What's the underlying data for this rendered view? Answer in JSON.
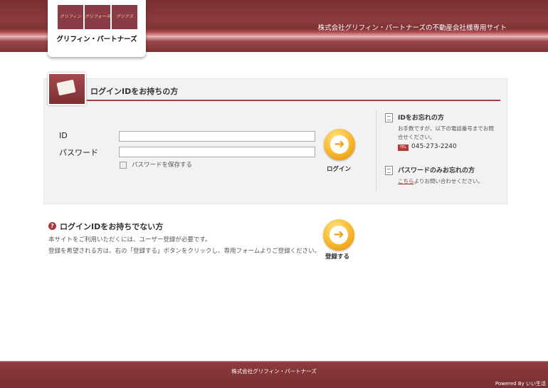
{
  "header": {
    "logo_tiles": [
      "グリフィン",
      "グリフォーネ",
      "グリアス"
    ],
    "logo_name": "グリフィン・パートナーズ",
    "site_title": "株式会社グリフィン・パートナーズの不動産会社様専用サイト"
  },
  "login": {
    "title": "ログインIDをお持ちの方",
    "id_label": "ID",
    "id_value": "",
    "password_label": "パスワード",
    "password_value": "",
    "save_password_label": "パスワードを保存する",
    "save_password_checked": false,
    "login_button_label": "ログイン"
  },
  "help": {
    "forgot_id_title": "IDをお忘れの方",
    "forgot_id_text": "お手数ですが、以下の電話番号までお問合せください。",
    "tel_badge": "TEL",
    "tel_number": "045-273-2240",
    "forgot_pw_title": "パスワードのみお忘れの方",
    "forgot_pw_link": "こちら",
    "forgot_pw_text": "よりお問い合わせください。"
  },
  "register": {
    "title": "ログインIDをお持ちでない方",
    "line1": "本サイトをご利用いただくには、ユーザー登録が必要です。",
    "line2": "登録を希望される方は、右の「登録する」ボタンをクリックし、専用フォームよりご登録ください。",
    "button_label": "登録する"
  },
  "footer": {
    "company": "株式会社グリフィン・パートナーズ",
    "powered_by": "Powered By いい生活"
  },
  "colors": {
    "brand": "#8d3a3d",
    "accent_button": "#f8b62a"
  }
}
